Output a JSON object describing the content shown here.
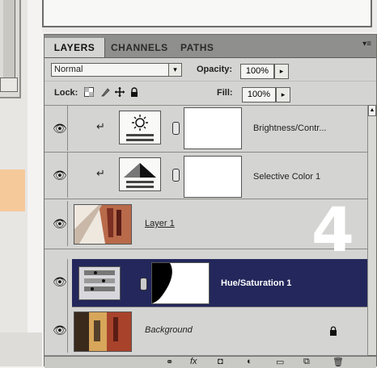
{
  "tabs": {
    "layers": "LAYERS",
    "channels": "CHANNELS",
    "paths": "PATHS",
    "menu_icon": "panel-menu-icon"
  },
  "blend": {
    "mode": "Normal",
    "opacity_label": "Opacity:",
    "opacity_value": "100%",
    "arrow": "▸",
    "dropdown_arrow": "▾"
  },
  "lock": {
    "label": "Lock:",
    "fill_label": "Fill:",
    "fill_value": "100%",
    "arrow": "▸"
  },
  "layers": [
    {
      "name": "Brightness/Contr...",
      "type": "adjustment",
      "icon": "brightness-contrast-icon",
      "clipped": true,
      "selected": false
    },
    {
      "name": "Selective Color 1",
      "type": "adjustment",
      "icon": "selective-color-icon",
      "clipped": true,
      "selected": false
    },
    {
      "name": "Layer 1",
      "type": "pixel",
      "clipped": false,
      "selected": false
    },
    {
      "name": "Hue/Saturation 1",
      "type": "adjustment",
      "icon": "hue-saturation-icon",
      "clipped": false,
      "selected": true
    },
    {
      "name": "Background",
      "type": "pixel",
      "locked": true,
      "clipped": false,
      "selected": false
    }
  ],
  "overlay_number": "4",
  "colors": {
    "selected_row": "#23275b",
    "panel_bg": "#d4d4d2",
    "accent_peach": "#f6c99b"
  },
  "bottom_icons": [
    "link-layers-icon",
    "fx-icon",
    "add-mask-icon",
    "new-adjustment-icon",
    "new-group-icon",
    "new-layer-icon",
    "delete-layer-icon"
  ]
}
